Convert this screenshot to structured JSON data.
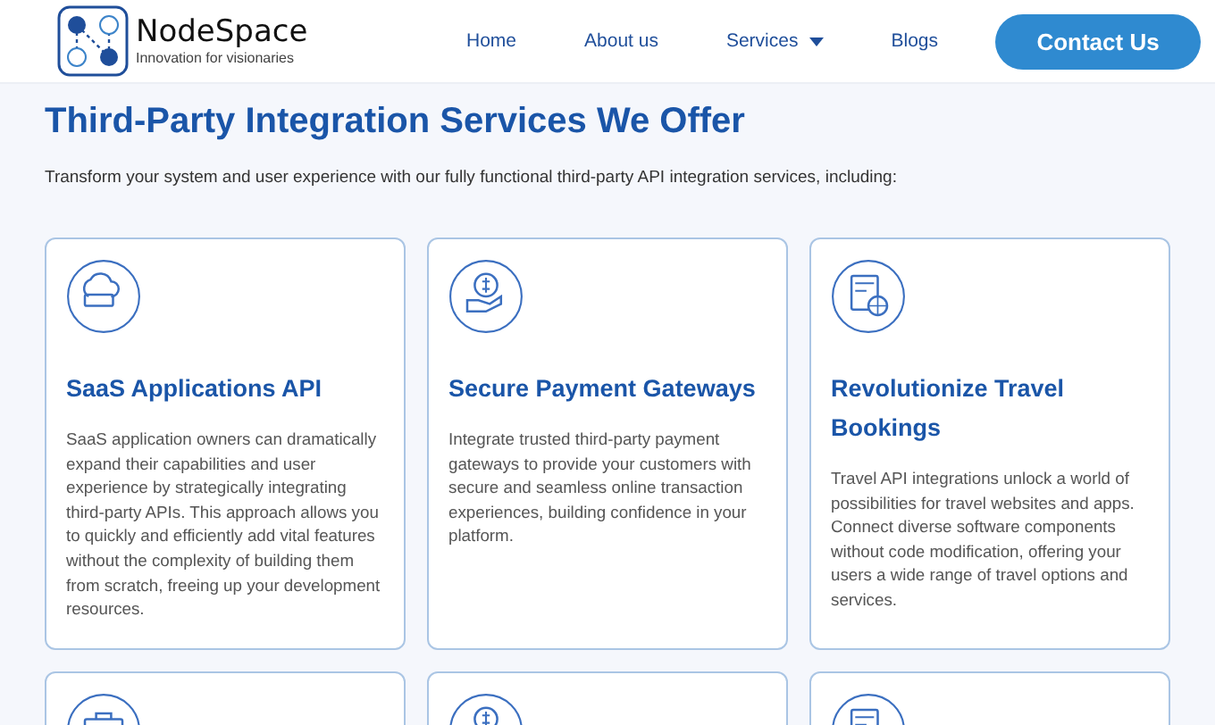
{
  "header": {
    "logo": {
      "name": "NodeSpace",
      "tagline": "Innovation for visionaries"
    },
    "nav": [
      {
        "label": "Home",
        "dropdown": false
      },
      {
        "label": "About us",
        "dropdown": false
      },
      {
        "label": "Services",
        "dropdown": true
      },
      {
        "label": "Blogs",
        "dropdown": false
      }
    ],
    "cta": "Contact Us"
  },
  "section": {
    "title": "Third-Party Integration Services We Offer",
    "intro": "Transform your system and user experience with our fully functional third-party API integration services, including:",
    "cards": [
      {
        "kind": "full",
        "title": "SaaS Applications API",
        "body": "SaaS application owners can dramatically expand their capabilities and user experience by strategically integrating third-party APIs. This approach allows you to quickly and efficiently add vital features without the complexity of building them from scratch, freeing up your development resources."
      },
      {
        "kind": "full",
        "title": "Secure Payment Gateways",
        "body": "Integrate trusted third-party payment gateways to provide your customers with secure and seamless online transaction experiences, building confidence in your platform."
      },
      {
        "kind": "full",
        "title": "Revolutionize Travel Bookings",
        "body": "Travel API integrations unlock a world of possibilities for travel websites and apps. Connect diverse software components without code modification, offering your users a wide range of travel options and services."
      },
      {
        "kind": "partial"
      },
      {
        "kind": "partial"
      },
      {
        "kind": "partial"
      }
    ]
  }
}
